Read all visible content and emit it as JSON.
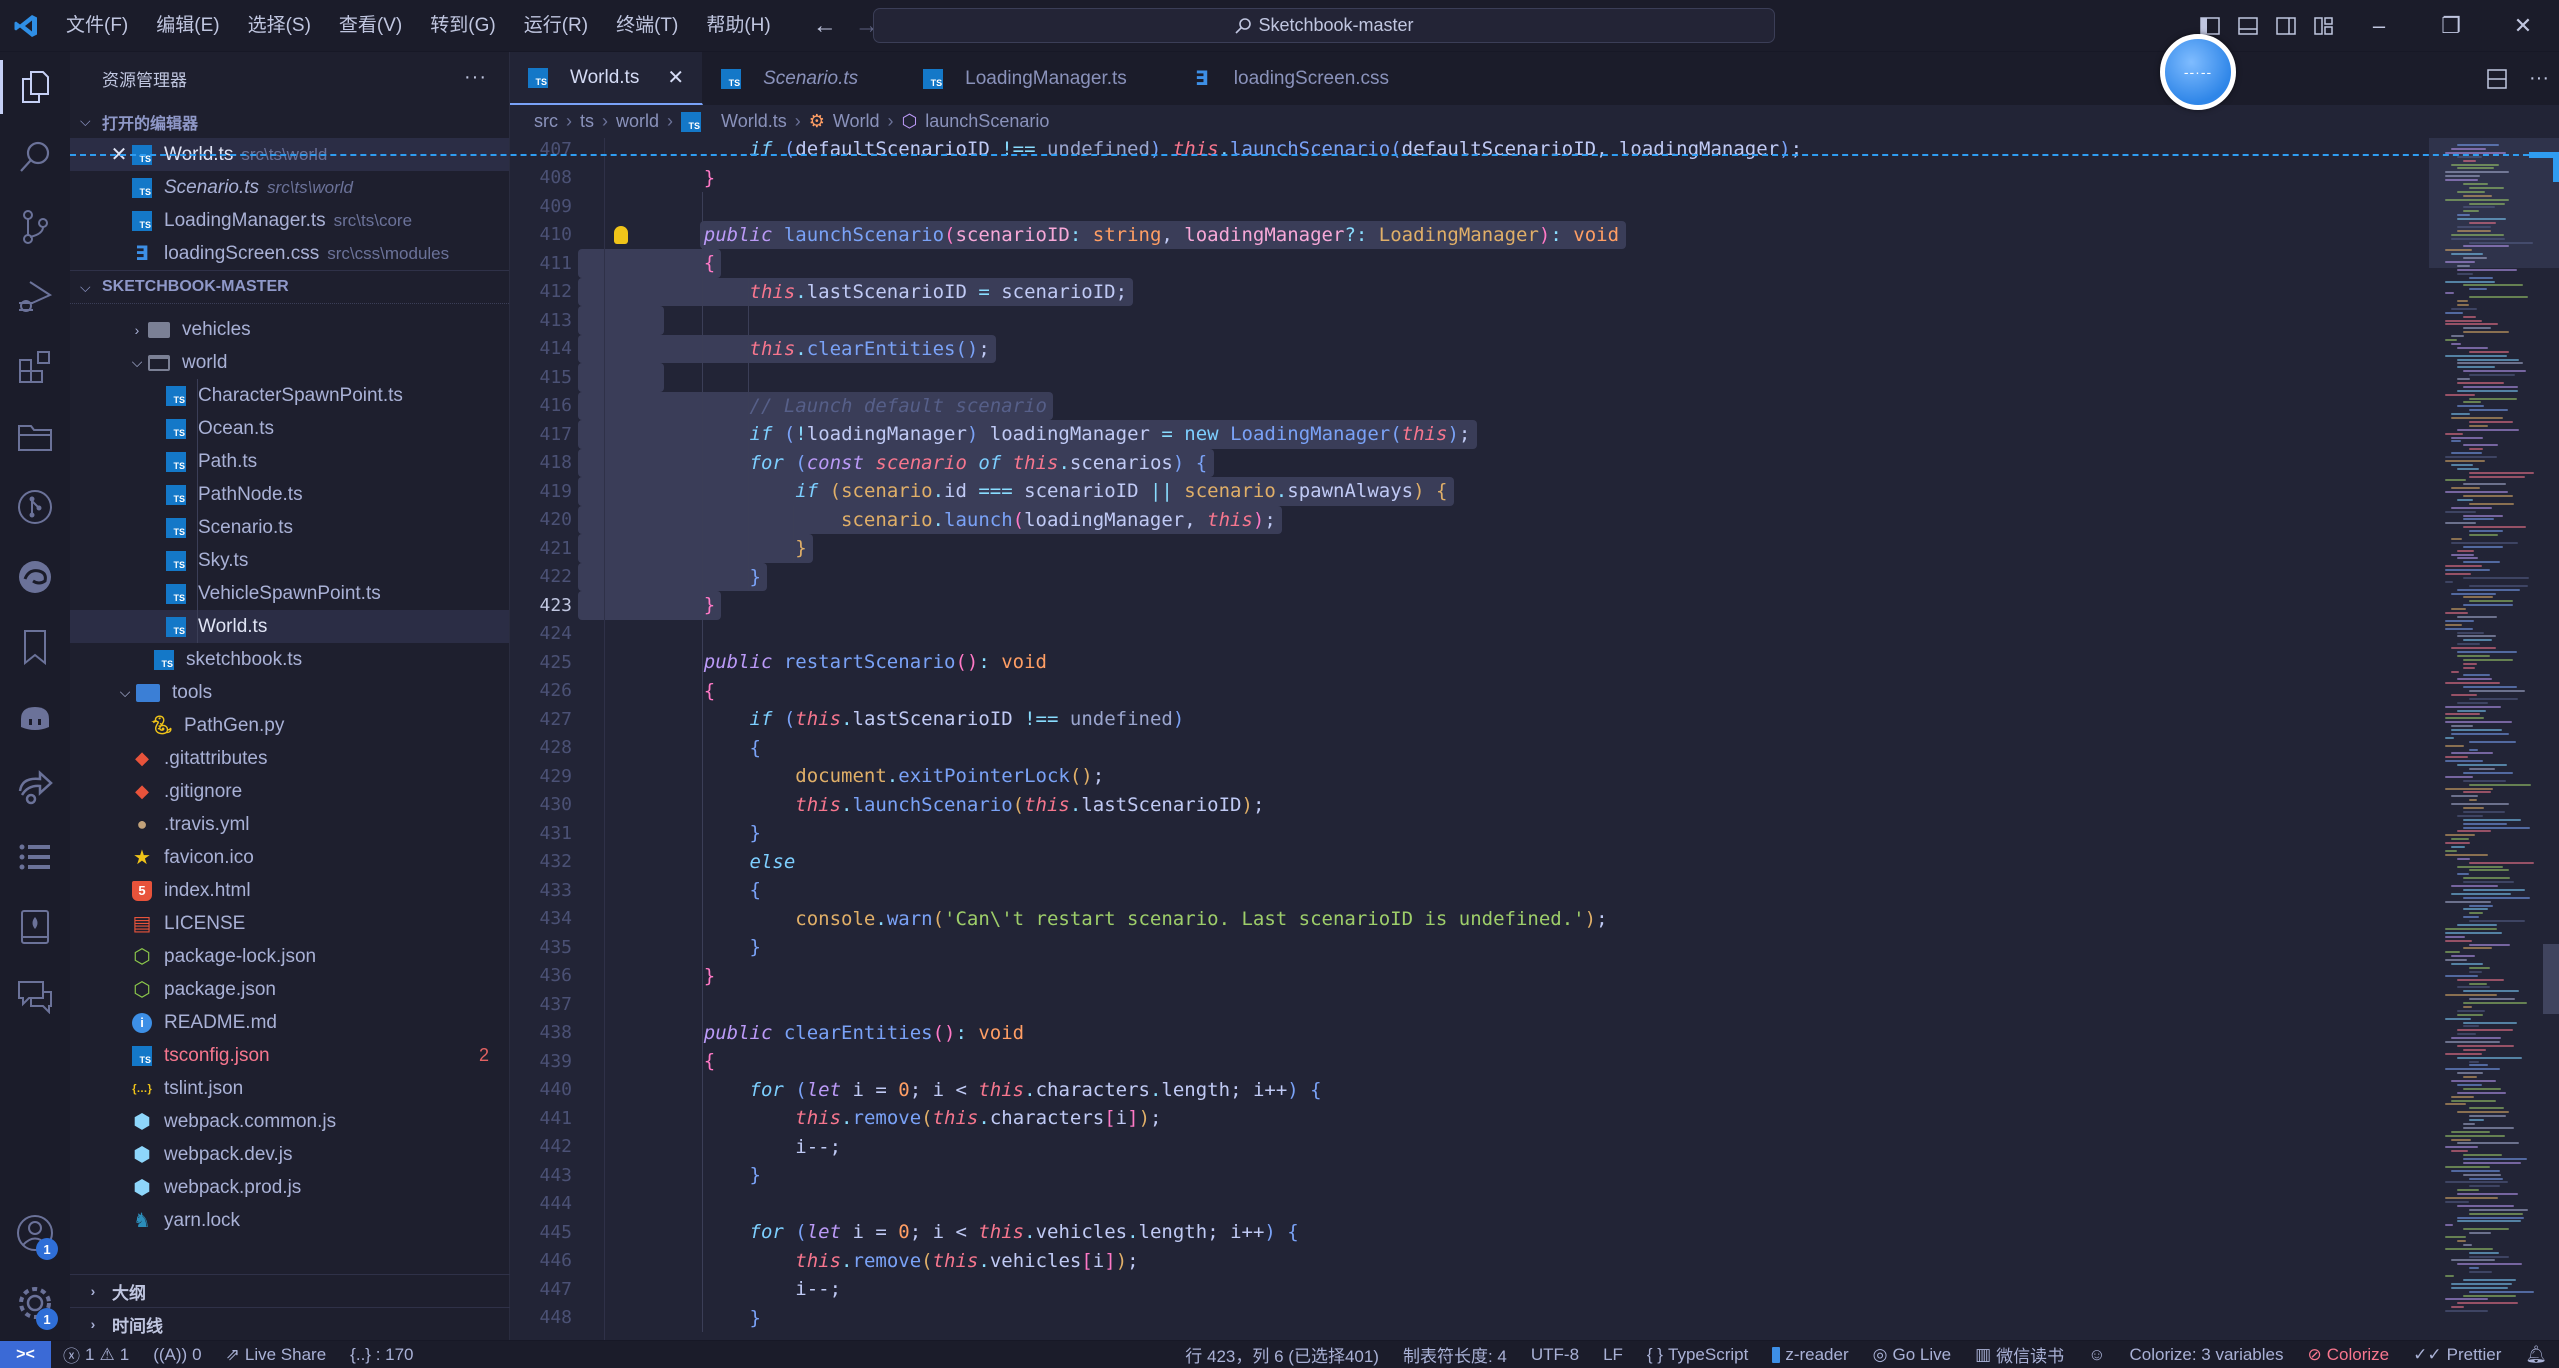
{
  "titlebar": {
    "menu": [
      "文件(F)",
      "编辑(E)",
      "选择(S)",
      "查看(V)",
      "转到(G)",
      "运行(R)",
      "终端(T)",
      "帮助(H)"
    ],
    "search_text": "Sketchbook-master",
    "window_controls": [
      "minimize",
      "restore",
      "close"
    ]
  },
  "activity_bar": {
    "items": [
      "explorer",
      "search",
      "source-control",
      "run-debug",
      "extensions",
      "project-manager",
      "git-graph",
      "edge-devtools",
      "bookmarks",
      "copilot",
      "live-share",
      "outline-list",
      "book-reader",
      "comments"
    ],
    "accounts_badge": "1",
    "settings_badge": "1"
  },
  "sidebar": {
    "title": "资源管理器",
    "more": "···",
    "open_editors_label": "打开的编辑器",
    "open_editors": [
      {
        "name": "World.ts",
        "path": "src\\ts\\world",
        "icon": "ts",
        "active": true,
        "italic": false
      },
      {
        "name": "Scenario.ts",
        "path": "src\\ts\\world",
        "icon": "ts",
        "active": false,
        "italic": true
      },
      {
        "name": "LoadingManager.ts",
        "path": "src\\ts\\core",
        "icon": "ts",
        "active": false,
        "italic": false
      },
      {
        "name": "loadingScreen.css",
        "path": "src\\css\\modules",
        "icon": "css",
        "active": false,
        "italic": false
      }
    ],
    "project_label": "SKETCHBOOK-MASTER",
    "tree": [
      {
        "name": "vehicles",
        "type": "folder",
        "expanded": false
      },
      {
        "name": "world",
        "type": "folder",
        "expanded": true
      },
      {
        "name": "CharacterSpawnPoint.ts",
        "type": "ts"
      },
      {
        "name": "Ocean.ts",
        "type": "ts"
      },
      {
        "name": "Path.ts",
        "type": "ts"
      },
      {
        "name": "PathNode.ts",
        "type": "ts"
      },
      {
        "name": "Scenario.ts",
        "type": "ts"
      },
      {
        "name": "Sky.ts",
        "type": "ts"
      },
      {
        "name": "VehicleSpawnPoint.ts",
        "type": "ts"
      },
      {
        "name": "World.ts",
        "type": "ts",
        "selected": true
      },
      {
        "name": "sketchbook.ts",
        "type": "ts"
      },
      {
        "name": "tools",
        "type": "folder",
        "expanded": true
      },
      {
        "name": "PathGen.py",
        "type": "py"
      },
      {
        "name": ".gitattributes",
        "type": "git"
      },
      {
        "name": ".gitignore",
        "type": "git"
      },
      {
        "name": ".travis.yml",
        "type": "travis"
      },
      {
        "name": "favicon.ico",
        "type": "star"
      },
      {
        "name": "index.html",
        "type": "html"
      },
      {
        "name": "LICENSE",
        "type": "license"
      },
      {
        "name": "package-lock.json",
        "type": "node"
      },
      {
        "name": "package.json",
        "type": "node"
      },
      {
        "name": "README.md",
        "type": "info"
      },
      {
        "name": "tsconfig.json",
        "type": "tsconfig",
        "error": true,
        "problems": "2"
      },
      {
        "name": "tslint.json",
        "type": "json"
      },
      {
        "name": "webpack.common.js",
        "type": "webpack"
      },
      {
        "name": "webpack.dev.js",
        "type": "webpack"
      },
      {
        "name": "webpack.prod.js",
        "type": "webpack"
      },
      {
        "name": "yarn.lock",
        "type": "yarn"
      }
    ],
    "outline_label": "大纲",
    "timeline_label": "时间线"
  },
  "tabs": [
    {
      "label": "World.ts",
      "icon": "ts",
      "active": true,
      "italic": false
    },
    {
      "label": "Scenario.ts",
      "icon": "ts",
      "active": false,
      "italic": true
    },
    {
      "label": "LoadingManager.ts",
      "icon": "ts",
      "active": false,
      "italic": false
    },
    {
      "label": "loadingScreen.css",
      "icon": "css",
      "active": false,
      "italic": false
    }
  ],
  "breadcrumb": [
    "src",
    "ts",
    "world",
    "World.ts",
    "World",
    "launchScenario"
  ],
  "code": {
    "first_line": 407,
    "current_line": 423,
    "lines": [
      [
        [
          "        ",
          ""
        ],
        [
          "if",
          "ctl"
        ],
        [
          " (",
          "br2"
        ],
        [
          "defaultScenarioID",
          "var"
        ],
        [
          " !== ",
          "op"
        ],
        [
          "undefined",
          "undef"
        ],
        [
          ") ",
          "br2"
        ],
        [
          "this",
          "this"
        ],
        [
          ".",
          "op"
        ],
        [
          "launchScenario",
          "fn"
        ],
        [
          "(",
          "br2"
        ],
        [
          "defaultScenarioID, loadingManager",
          "var"
        ],
        [
          ")",
          "br2"
        ],
        [
          ";",
          "var"
        ]
      ],
      [
        [
          "    ",
          ""
        ],
        [
          "}",
          "br1"
        ]
      ],
      [
        [
          "",
          ""
        ]
      ],
      [
        [
          "    ",
          ""
        ],
        [
          "public",
          "kw-pub"
        ],
        [
          " ",
          ""
        ],
        [
          "launchScenario",
          "fn"
        ],
        [
          "(",
          "br1"
        ],
        [
          "scenarioID",
          "param"
        ],
        [
          ": ",
          "op"
        ],
        [
          "string",
          "ty"
        ],
        [
          ", ",
          "var"
        ],
        [
          "loadingManager",
          "param"
        ],
        [
          "?: ",
          "op"
        ],
        [
          "LoadingManager",
          "cls"
        ],
        [
          ")",
          "br1"
        ],
        [
          ": ",
          "op"
        ],
        [
          "void",
          "ty"
        ]
      ],
      [
        [
          "    ",
          ""
        ],
        [
          "{",
          "br1"
        ]
      ],
      [
        [
          "        ",
          ""
        ],
        [
          "this",
          "this"
        ],
        [
          ".",
          "op"
        ],
        [
          "lastScenarioID",
          "prop"
        ],
        [
          " = ",
          "op"
        ],
        [
          "scenarioID",
          "var"
        ],
        [
          ";",
          "var"
        ]
      ],
      [
        [
          "",
          ""
        ]
      ],
      [
        [
          "        ",
          ""
        ],
        [
          "this",
          "this"
        ],
        [
          ".",
          "op"
        ],
        [
          "clearEntities",
          "fn"
        ],
        [
          "()",
          "br2"
        ],
        [
          ";",
          "var"
        ]
      ],
      [
        [
          "",
          ""
        ]
      ],
      [
        [
          "        ",
          ""
        ],
        [
          "// Launch default scenario",
          "cmt"
        ]
      ],
      [
        [
          "        ",
          ""
        ],
        [
          "if",
          "ctl"
        ],
        [
          " (",
          "br2"
        ],
        [
          "!",
          "op"
        ],
        [
          "loadingManager",
          "var"
        ],
        [
          ") ",
          "br2"
        ],
        [
          "loadingManager",
          "var"
        ],
        [
          " = ",
          "op"
        ],
        [
          "new",
          "new"
        ],
        [
          " ",
          ""
        ],
        [
          "LoadingManager",
          "fn"
        ],
        [
          "(",
          "br2"
        ],
        [
          "this",
          "this"
        ],
        [
          ")",
          "br2"
        ],
        [
          ";",
          "var"
        ]
      ],
      [
        [
          "        ",
          ""
        ],
        [
          "for",
          "ctl"
        ],
        [
          " (",
          "br2"
        ],
        [
          "const",
          "let"
        ],
        [
          " ",
          ""
        ],
        [
          "scenario",
          "this"
        ],
        [
          " ",
          ""
        ],
        [
          "of",
          "ctl"
        ],
        [
          " ",
          ""
        ],
        [
          "this",
          "this"
        ],
        [
          ".",
          "op"
        ],
        [
          "scenarios",
          "prop"
        ],
        [
          ") ",
          "br2"
        ],
        [
          "{",
          "br2"
        ]
      ],
      [
        [
          "            ",
          ""
        ],
        [
          "if",
          "ctl"
        ],
        [
          " (",
          "br3"
        ],
        [
          "scenario",
          "obj"
        ],
        [
          ".",
          "op"
        ],
        [
          "id",
          "prop"
        ],
        [
          " === ",
          "op"
        ],
        [
          "scenarioID",
          "var"
        ],
        [
          " || ",
          "op"
        ],
        [
          "scenario",
          "obj"
        ],
        [
          ".",
          "op"
        ],
        [
          "spawnAlways",
          "prop"
        ],
        [
          ") ",
          "br3"
        ],
        [
          "{",
          "br3"
        ]
      ],
      [
        [
          "                ",
          ""
        ],
        [
          "scenario",
          "obj"
        ],
        [
          ".",
          "op"
        ],
        [
          "launch",
          "fn"
        ],
        [
          "(",
          "br1"
        ],
        [
          "loadingManager, ",
          "var"
        ],
        [
          "this",
          "this"
        ],
        [
          ")",
          "br1"
        ],
        [
          ";",
          "var"
        ]
      ],
      [
        [
          "            ",
          ""
        ],
        [
          "}",
          "br3"
        ]
      ],
      [
        [
          "        ",
          ""
        ],
        [
          "}",
          "br2"
        ]
      ],
      [
        [
          "    ",
          ""
        ],
        [
          "}",
          "br1"
        ]
      ],
      [
        [
          "",
          ""
        ]
      ],
      [
        [
          "    ",
          ""
        ],
        [
          "public",
          "kw-pub"
        ],
        [
          " ",
          ""
        ],
        [
          "restartScenario",
          "fn"
        ],
        [
          "()",
          "br1"
        ],
        [
          ": ",
          "op"
        ],
        [
          "void",
          "ty"
        ]
      ],
      [
        [
          "    ",
          ""
        ],
        [
          "{",
          "br1"
        ]
      ],
      [
        [
          "        ",
          ""
        ],
        [
          "if",
          "ctl"
        ],
        [
          " (",
          "br2"
        ],
        [
          "this",
          "this"
        ],
        [
          ".",
          "op"
        ],
        [
          "lastScenarioID",
          "prop"
        ],
        [
          " !== ",
          "op"
        ],
        [
          "undefined",
          "undef"
        ],
        [
          ")",
          "br2"
        ]
      ],
      [
        [
          "        ",
          ""
        ],
        [
          "{",
          "br2"
        ]
      ],
      [
        [
          "            ",
          ""
        ],
        [
          "document",
          "obj"
        ],
        [
          ".",
          "op"
        ],
        [
          "exitPointerLock",
          "fn"
        ],
        [
          "()",
          "br3"
        ],
        [
          ";",
          "var"
        ]
      ],
      [
        [
          "            ",
          ""
        ],
        [
          "this",
          "this"
        ],
        [
          ".",
          "op"
        ],
        [
          "launchScenario",
          "fn"
        ],
        [
          "(",
          "br3"
        ],
        [
          "this",
          "this"
        ],
        [
          ".",
          "op"
        ],
        [
          "lastScenarioID",
          "prop"
        ],
        [
          ")",
          "br3"
        ],
        [
          ";",
          "var"
        ]
      ],
      [
        [
          "        ",
          ""
        ],
        [
          "}",
          "br2"
        ]
      ],
      [
        [
          "        ",
          ""
        ],
        [
          "else",
          "ctl"
        ]
      ],
      [
        [
          "        ",
          ""
        ],
        [
          "{",
          "br2"
        ]
      ],
      [
        [
          "            ",
          ""
        ],
        [
          "console",
          "obj"
        ],
        [
          ".",
          "op"
        ],
        [
          "warn",
          "fn"
        ],
        [
          "(",
          "br3"
        ],
        [
          "'Can\\'t restart scenario. Last scenarioID is undefined.'",
          "str"
        ],
        [
          ")",
          "br3"
        ],
        [
          ";",
          "var"
        ]
      ],
      [
        [
          "        ",
          ""
        ],
        [
          "}",
          "br2"
        ]
      ],
      [
        [
          "    ",
          ""
        ],
        [
          "}",
          "br1"
        ]
      ],
      [
        [
          "",
          ""
        ]
      ],
      [
        [
          "    ",
          ""
        ],
        [
          "public",
          "kw-pub"
        ],
        [
          " ",
          ""
        ],
        [
          "clearEntities",
          "fn"
        ],
        [
          "()",
          "br1"
        ],
        [
          ": ",
          "op"
        ],
        [
          "void",
          "ty"
        ]
      ],
      [
        [
          "    ",
          ""
        ],
        [
          "{",
          "br1"
        ]
      ],
      [
        [
          "        ",
          ""
        ],
        [
          "for",
          "ctl"
        ],
        [
          " (",
          "br2"
        ],
        [
          "let",
          "let"
        ],
        [
          " i = ",
          "var"
        ],
        [
          "0",
          "num"
        ],
        [
          "; i < ",
          "var"
        ],
        [
          "this",
          "this"
        ],
        [
          ".",
          "op"
        ],
        [
          "characters",
          "prop"
        ],
        [
          ".",
          "op"
        ],
        [
          "length",
          "prop"
        ],
        [
          "; i++",
          "var"
        ],
        [
          ") ",
          "br2"
        ],
        [
          "{",
          "br2"
        ]
      ],
      [
        [
          "            ",
          ""
        ],
        [
          "this",
          "this"
        ],
        [
          ".",
          "op"
        ],
        [
          "remove",
          "fn"
        ],
        [
          "(",
          "br3"
        ],
        [
          "this",
          "this"
        ],
        [
          ".",
          "op"
        ],
        [
          "characters",
          "prop"
        ],
        [
          "[",
          "br1"
        ],
        [
          "i",
          "var"
        ],
        [
          "]",
          "br1"
        ],
        [
          ")",
          "br3"
        ],
        [
          ";",
          "var"
        ]
      ],
      [
        [
          "            ",
          ""
        ],
        [
          "i--;",
          "var"
        ]
      ],
      [
        [
          "        ",
          ""
        ],
        [
          "}",
          "br2"
        ]
      ],
      [
        [
          "",
          ""
        ]
      ],
      [
        [
          "        ",
          ""
        ],
        [
          "for",
          "ctl"
        ],
        [
          " (",
          "br2"
        ],
        [
          "let",
          "let"
        ],
        [
          " i = ",
          "var"
        ],
        [
          "0",
          "num"
        ],
        [
          "; i < ",
          "var"
        ],
        [
          "this",
          "this"
        ],
        [
          ".",
          "op"
        ],
        [
          "vehicles",
          "prop"
        ],
        [
          ".",
          "op"
        ],
        [
          "length",
          "prop"
        ],
        [
          "; i++",
          "var"
        ],
        [
          ") ",
          "br2"
        ],
        [
          "{",
          "br2"
        ]
      ],
      [
        [
          "            ",
          ""
        ],
        [
          "this",
          "this"
        ],
        [
          ".",
          "op"
        ],
        [
          "remove",
          "fn"
        ],
        [
          "(",
          "br3"
        ],
        [
          "this",
          "this"
        ],
        [
          ".",
          "op"
        ],
        [
          "vehicles",
          "prop"
        ],
        [
          "[",
          "br1"
        ],
        [
          "i",
          "var"
        ],
        [
          "]",
          "br1"
        ],
        [
          ")",
          "br3"
        ],
        [
          ";",
          "var"
        ]
      ],
      [
        [
          "            ",
          ""
        ],
        [
          "i--;",
          "var"
        ]
      ],
      [
        [
          "        ",
          ""
        ],
        [
          "}",
          "br2"
        ]
      ]
    ],
    "selected_lines": [
      410,
      411,
      412,
      413,
      414,
      415,
      416,
      417,
      418,
      419,
      420,
      421,
      422,
      423
    ]
  },
  "statusbar": {
    "errors": "1",
    "warnings": "1",
    "ports": "0",
    "live_share": "Live Share",
    "bracket_info": "{..} : 170",
    "cursor": "行 423，列 6 (已选择401)",
    "tab_size": "制表符长度: 4",
    "encoding": "UTF-8",
    "eol": "LF",
    "language": "TypeScript",
    "z_reader": "z-reader",
    "go_live": "Go Live",
    "weread": "微信读书",
    "colorize_vars": "Colorize: 3 variables",
    "colorize": "Colorize",
    "prettier": "Prettier"
  }
}
